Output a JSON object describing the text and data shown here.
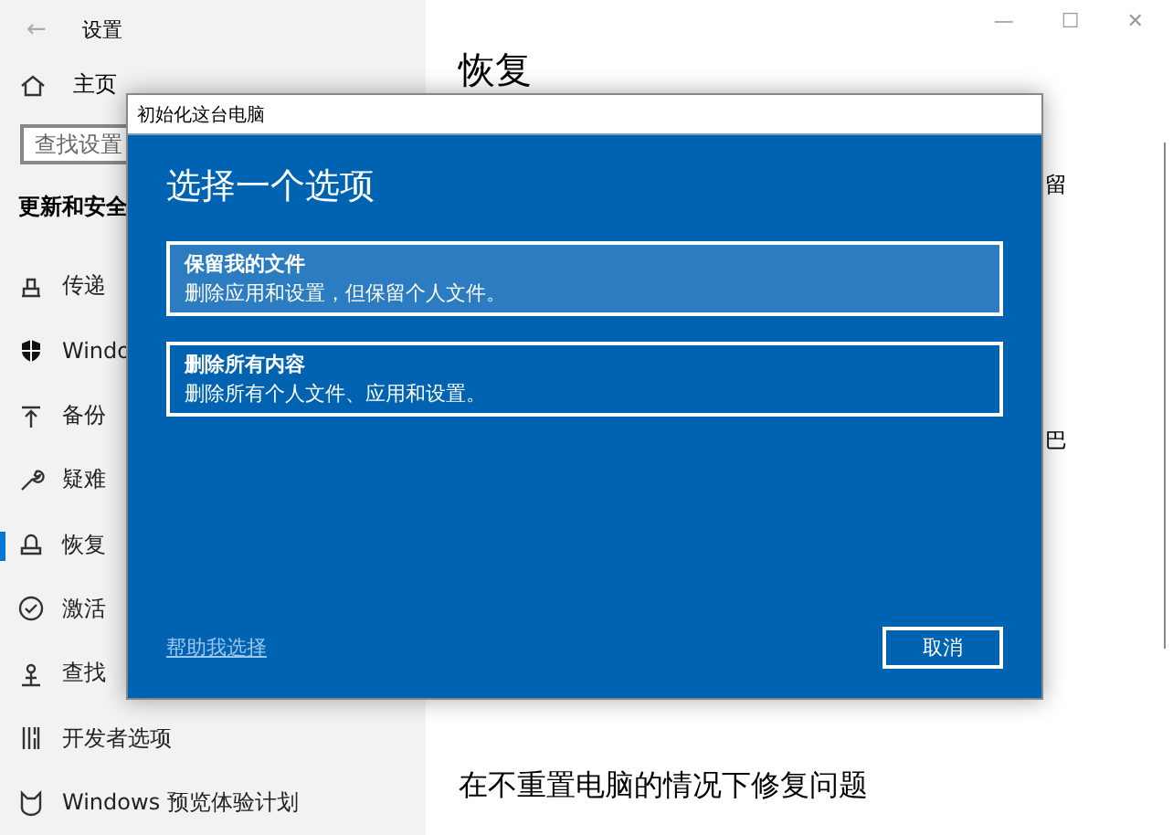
{
  "window": {
    "title": "设置",
    "back": "←",
    "controls": [
      "—",
      "☐",
      "✕"
    ]
  },
  "sidebar": {
    "home": "主页",
    "search": {
      "placeholder": "查找设置"
    },
    "section": "更新和安全",
    "items": [
      {
        "label": "传递",
        "kind": "delivery",
        "selected": false
      },
      {
        "label": "Windo",
        "kind": "shield",
        "selected": false
      },
      {
        "label": "备份",
        "kind": "backup",
        "selected": false
      },
      {
        "label": "疑难",
        "kind": "wrench",
        "selected": false
      },
      {
        "label": "恢复",
        "kind": "recovery",
        "selected": true
      },
      {
        "label": "激活",
        "kind": "check",
        "selected": false
      },
      {
        "label": "查找",
        "kind": "person",
        "selected": false
      },
      {
        "label": "开发者选项",
        "kind": "dev",
        "selected": false
      },
      {
        "label": "Windows 预览体验计划",
        "kind": "cat",
        "selected": false
      }
    ]
  },
  "main": {
    "title": "恢复",
    "fragment_1": "留",
    "fragment_2": "巴",
    "section_title": "在不重置电脑的情况下修复问题"
  },
  "dialog": {
    "title": "初始化这台电脑",
    "heading": "选择一个选项",
    "options": [
      {
        "title": "保留我的文件",
        "description": "删除应用和设置，但保留个人文件。",
        "highlighted": true
      },
      {
        "title": "删除所有内容",
        "description": "删除所有个人文件、应用和设置。",
        "highlighted": false
      }
    ],
    "help_link": "帮助我选择",
    "cancel": "取消"
  }
}
